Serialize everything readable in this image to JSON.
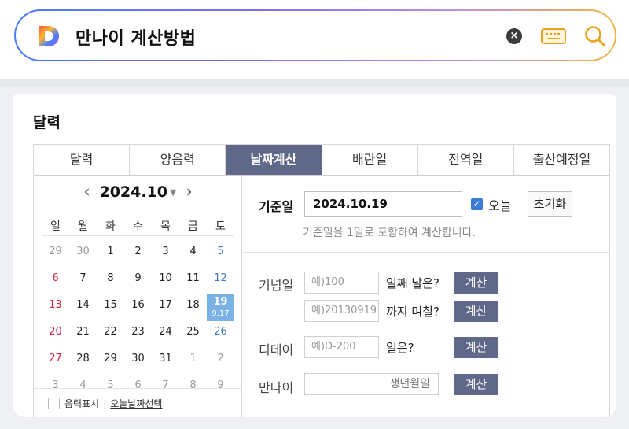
{
  "search": {
    "query": "만나이 계산방법",
    "logo_letter": "D"
  },
  "widget": {
    "title": "달력",
    "tabs": [
      "달력",
      "양음력",
      "날짜계산",
      "배란일",
      "전역일",
      "출산예정일"
    ],
    "active_tab_index": 2
  },
  "calendar": {
    "prev_label": "‹",
    "next_label": "›",
    "month_label": "2024.10",
    "dropdown_label": "▼",
    "weekdays": [
      "일",
      "월",
      "화",
      "수",
      "목",
      "금",
      "토"
    ],
    "weeks": [
      [
        "29",
        "30",
        "1",
        "2",
        "3",
        "4",
        "5"
      ],
      [
        "6",
        "7",
        "8",
        "9",
        "10",
        "11",
        "12"
      ],
      [
        "13",
        "14",
        "15",
        "16",
        "17",
        "18",
        "19"
      ],
      [
        "20",
        "21",
        "22",
        "23",
        "24",
        "25",
        "26"
      ],
      [
        "27",
        "28",
        "29",
        "30",
        "31",
        "1",
        "2"
      ],
      [
        "3",
        "4",
        "5",
        "6",
        "7",
        "8",
        "9"
      ]
    ],
    "other_month": [
      [
        0,
        1
      ],
      [],
      [],
      [],
      [
        5,
        6
      ],
      [
        0,
        1,
        2,
        3,
        4,
        5,
        6
      ]
    ],
    "selected": {
      "week": 2,
      "day": 6,
      "lunar": "9.17"
    },
    "lunar_toggle_label": "음력표시",
    "today_select_label": "오늘날짜선택"
  },
  "calc": {
    "base_label": "기준일",
    "base_value": "2024.10.19",
    "today_label": "오늘",
    "reset_label": "초기화",
    "hint": "기준일을 1일로 포함하여 계산합니다.",
    "anniv_label": "기념일",
    "anniv_placeholder": "예)100",
    "anniv_suffix": "일째 날은?",
    "since_placeholder": "예)20130919",
    "since_suffix": "까지 며칠?",
    "dday_label": "디데이",
    "dday_placeholder": "예)D-200",
    "dday_suffix": "일은?",
    "age_label": "만나이",
    "age_placeholder": "생년월일",
    "calc_button": "계산"
  },
  "colors": {
    "accent_tab": "#5f6888",
    "selected_day": "#7ab2e6",
    "sunday": "#d1243a",
    "saturday": "#3d76c6"
  }
}
